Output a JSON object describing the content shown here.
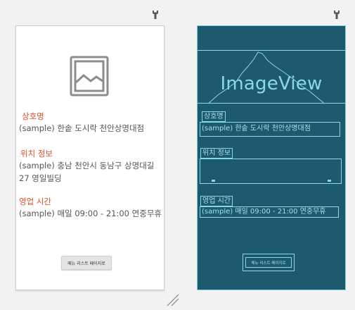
{
  "design": {
    "store_name_label": "상호명",
    "store_name_value": "(sample) 한솥 도시락 천안상명대점",
    "location_label": "위치 정보",
    "location_value_line1": "(sample) 충남 천안시 동남구 상명대길",
    "location_value_line2": "27 영일빌딩",
    "hours_label": "영업 시간",
    "hours_value": "(sample) 매일 09:00 - 21:00 연중무휴",
    "menu_button_label": "메뉴 리스트 페이지로"
  },
  "blueprint": {
    "image_view_label": "ImageView",
    "store_name_label": "상호명",
    "store_name_value": "(sample) 한솥 도시락 천안상명대점",
    "location_label": "위치 정보",
    "hours_label": "영업 시간",
    "hours_value": "(sample) 매일 09:00 - 21:00 연중무휴",
    "menu_button_label": "메뉴 리스트 페이지로"
  },
  "icons": {
    "pin": "wrench-icon",
    "image": "image-placeholder-icon",
    "resize": "resize-handle-icon"
  },
  "colors": {
    "label_accent": "#e0502e",
    "blueprint_bg": "#1e5a6e",
    "blueprint_line": "#8ad8e6"
  }
}
